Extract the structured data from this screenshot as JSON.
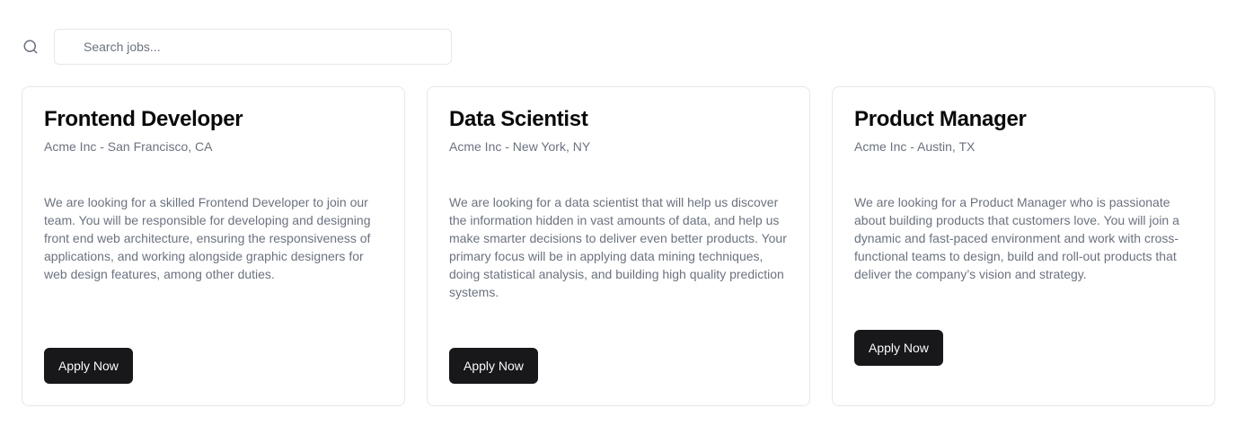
{
  "search": {
    "icon": "search-icon",
    "placeholder": "Search jobs..."
  },
  "jobs": [
    {
      "title": "Frontend Developer",
      "subtitle": "Acme Inc - San Francisco, CA",
      "description": "We are looking for a skilled Frontend Developer to join our team. You will be responsible for developing and designing front end web architecture, ensuring the responsiveness of applications, and working alongside graphic designers for web design features, among other duties.",
      "button_label": "Apply Now"
    },
    {
      "title": "Data Scientist",
      "subtitle": "Acme Inc - New York, NY",
      "description": "We are looking for a data scientist that will help us discover the information hidden in vast amounts of data, and help us make smarter decisions to deliver even better products. Your primary focus will be in applying data mining techniques, doing statistical analysis, and building high quality prediction systems.",
      "button_label": "Apply Now"
    },
    {
      "title": "Product Manager",
      "subtitle": "Acme Inc - Austin, TX",
      "description": "We are looking for a Product Manager who is passionate about building products that customers love. You will join a dynamic and fast-paced environment and work with cross-functional teams to design, build and roll-out products that deliver the company’s vision and strategy.",
      "button_label": "Apply Now"
    }
  ],
  "colors": {
    "button_bg": "#18181b",
    "button_text": "#fafafa",
    "muted_text": "#6b7280",
    "border": "#e5e7eb"
  }
}
